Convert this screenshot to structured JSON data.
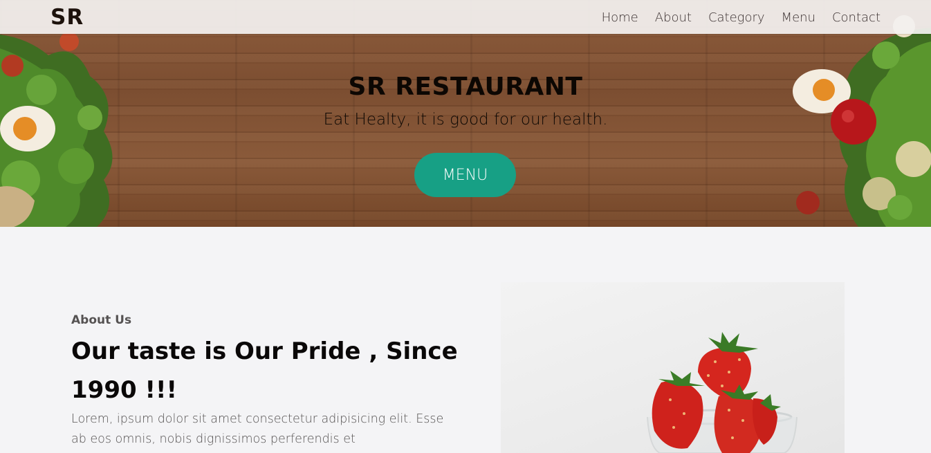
{
  "nav": {
    "logo": "SR",
    "links": [
      "Home",
      "About",
      "Category",
      "Menu",
      "Contact"
    ]
  },
  "hero": {
    "title": "SR RESTAURANT",
    "subtitle": "Eat Healty, it is good for our health.",
    "button_label": "MENU"
  },
  "about": {
    "tag": "About Us",
    "heading": "Our taste is Our Pride , Since 1990 !!!",
    "body": "Lorem, ipsum dolor sit amet consectetur adipisicing elit. Esse ab eos omnis, nobis dignissimos perferendis et"
  },
  "colors": {
    "accent": "#17a085",
    "nav_background": "#f3f1f0",
    "page_background": "#f4f4f6",
    "wood": "#8d5c3c"
  }
}
